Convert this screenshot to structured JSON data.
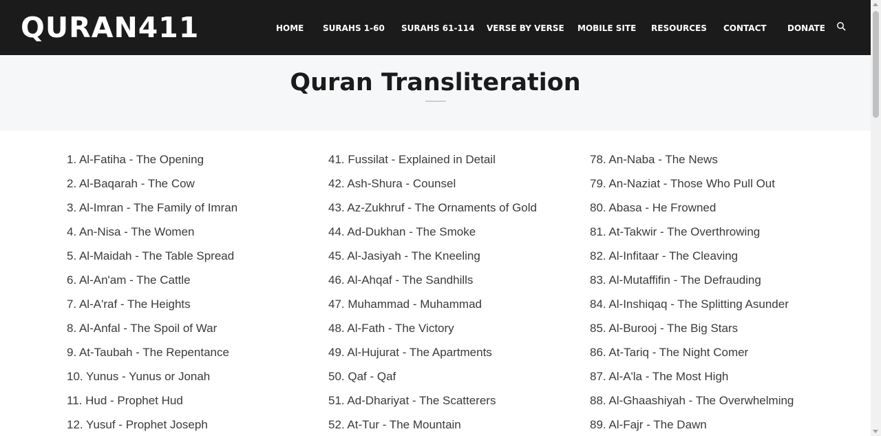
{
  "header": {
    "logo": "QURAN411",
    "nav": [
      "HOME",
      "SURAHS 1-60",
      "SURAHS 61-114",
      "VERSE BY VERSE",
      "MOBILE SITE",
      "RESOURCES",
      "CONTACT",
      "DONATE"
    ],
    "search_icon": "search-icon"
  },
  "page": {
    "title": "Quran Transliteration"
  },
  "surahs": {
    "col1": [
      "1. Al-Fatiha - The Opening",
      "2. Al-Baqarah - The Cow",
      "3. Al-Imran - The Family of Imran",
      "4. An-Nisa - The Women",
      "5. Al-Maidah - The Table Spread",
      "6. Al-An'am - The Cattle",
      "7. Al-A'raf - The Heights",
      "8. Al-Anfal - The Spoil of War",
      "9. At-Taubah - The Repentance",
      "10. Yunus - Yunus or Jonah",
      "11. Hud - Prophet Hud",
      "12. Yusuf - Prophet Joseph"
    ],
    "col2": [
      "41. Fussilat - Explained in Detail",
      "42. Ash-Shura - Counsel",
      "43. Az-Zukhruf - The Ornaments of Gold",
      "44. Ad-Dukhan - The Smoke",
      "45. Al-Jasiyah - The Kneeling",
      "46. Al-Ahqaf - The Sandhills",
      "47. Muhammad - Muhammad",
      "48. Al-Fath - The Victory",
      "49. Al-Hujurat - The Apartments",
      "50. Qaf - Qaf",
      "51. Ad-Dhariyat - The Scatterers",
      "52. At-Tur - The Mountain"
    ],
    "col3": [
      "78. An-Naba - The News",
      "79. An-Naziat - Those Who Pull Out",
      "80. Abasa - He Frowned",
      "81. At-Takwir - The Overthrowing",
      "82. Al-Infitaar - The Cleaving",
      "83. Al-Mutaffifin - The Defrauding",
      "84. Al-Inshiqaq - The Splitting Asunder",
      "85. Al-Burooj - The Big Stars",
      "86. At-Tariq - The Night Comer",
      "87. Al-A'la - The Most High",
      "88. Al-Ghaashiyah - The Overwhelming",
      "89. Al-Fajr - The Dawn"
    ]
  }
}
